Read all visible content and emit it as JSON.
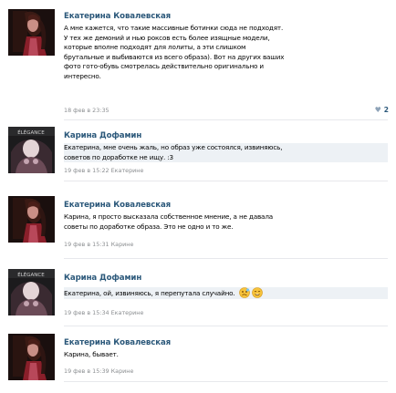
{
  "comments": [
    {
      "author": "Екатерина Ковалевская",
      "lines": [
        "А мне кажется, что такие массивные ботинки сюда не подходят.",
        "У тех же демоний и нью роксов есть более изящные модели,",
        "которые вполне подходят для лолиты, а эти слишком",
        "брутальные и выбиваются из всего образа). Вот на других ваших",
        "фото гото-обувь смотрелась действительно оригинально и",
        "интересно."
      ],
      "date": "18 фев в 23:35",
      "reply_to": "",
      "likes": "2"
    },
    {
      "author": "Карина Дофамин",
      "lines": [
        "Екатерина, мне очень жаль, но образ уже состоялся, извиняюсь,",
        "советов по доработке не ищу. :3"
      ],
      "date": "19 фев в 15:22",
      "reply_to": "Екатерине"
    },
    {
      "author": "Екатерина Ковалевская",
      "lines": [
        "Карина, я просто высказала собственное мнение, а не давала",
        "советы по доработке образа. Это не одно и то же."
      ],
      "date": "19 фев в 15:31",
      "reply_to": "Карине"
    },
    {
      "author": "Карина Дофамин",
      "lines": [
        "Екатерина, ой, извиняюсь, я перепутала случайно."
      ],
      "date": "19 фев в 15:34",
      "reply_to": "Екатерине",
      "emojis": [
        "confused-face-icon",
        "smiling-face-icon"
      ]
    },
    {
      "author": "Екатерина Ковалевская",
      "lines": [
        "Карина, бывает."
      ],
      "date": "19 фев в 15:39",
      "reply_to": "Карине"
    }
  ],
  "colors": {
    "author": "#2b587a",
    "meta": "#8b8e91",
    "highlight": "#edf1f5",
    "separator": "#e7e8ec"
  }
}
